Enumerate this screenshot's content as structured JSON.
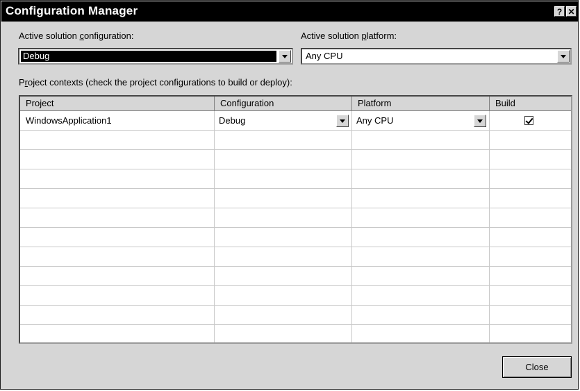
{
  "window": {
    "title": "Configuration Manager",
    "help_button": "?",
    "close_glyph": "✕"
  },
  "active_config": {
    "label_pre": "Active solution ",
    "label_accel": "c",
    "label_post": "onfiguration:",
    "value": "Debug"
  },
  "active_platform": {
    "label_pre": "Active solution ",
    "label_accel": "p",
    "label_post": "latform:",
    "value": "Any CPU"
  },
  "contexts": {
    "label_pre": "P",
    "label_accel": "r",
    "label_post": "oject contexts (check the project configurations to build or deploy):"
  },
  "grid": {
    "columns": [
      "Project",
      "Configuration",
      "Platform",
      "Build"
    ],
    "rows": [
      {
        "project": "WindowsApplication1",
        "configuration": "Debug",
        "platform": "Any CPU",
        "build": true
      }
    ]
  },
  "buttons": {
    "close": "Close"
  }
}
